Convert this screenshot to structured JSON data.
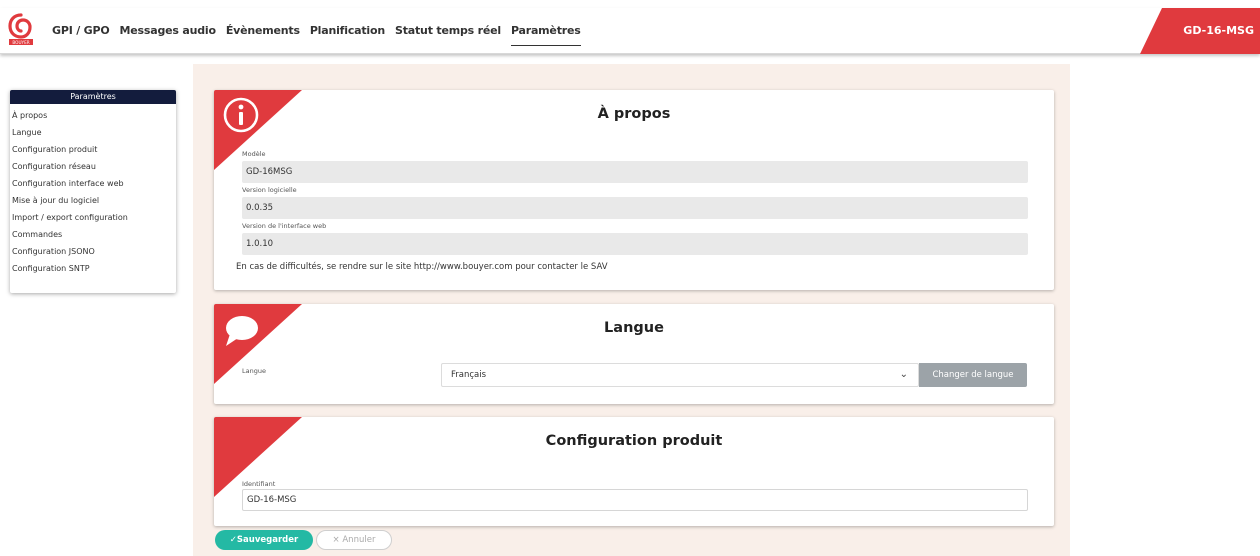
{
  "nav": {
    "items": [
      {
        "label": "GPI / GPO"
      },
      {
        "label": "Messages audio"
      },
      {
        "label": "Évènements"
      },
      {
        "label": "Planification"
      },
      {
        "label": "Statut temps réel"
      },
      {
        "label": "Paramètres"
      }
    ],
    "active_index": 5,
    "device": "GD-16-MSG"
  },
  "sidebar": {
    "title": "Paramètres",
    "items": [
      {
        "label": "À propos"
      },
      {
        "label": "Langue"
      },
      {
        "label": "Configuration produit"
      },
      {
        "label": "Configuration réseau"
      },
      {
        "label": "Configuration interface web"
      },
      {
        "label": "Mise à jour du logiciel"
      },
      {
        "label": "Import / export configuration"
      },
      {
        "label": "Commandes"
      },
      {
        "label": "Configuration JSONO"
      },
      {
        "label": "Configuration SNTP"
      }
    ]
  },
  "about": {
    "title": "À propos",
    "icon": "info-icon",
    "fields": [
      {
        "label": "Modèle",
        "value": "GD-16MSG"
      },
      {
        "label": "Version logicielle",
        "value": "0.0.35"
      },
      {
        "label": "Version de l'interface web",
        "value": "1.0.10"
      }
    ],
    "note": "En cas de difficultés, se rendre sur le site http://www.bouyer.com pour contacter le SAV"
  },
  "language": {
    "title": "Langue",
    "icon": "speech-bubble-icon",
    "label": "Langue",
    "selected": "Français",
    "button": "Changer de langue"
  },
  "product": {
    "title": "Configuration produit",
    "label": "Identifiant",
    "value": "GD-16-MSG"
  },
  "actions": {
    "save": "✓Sauvegarder",
    "cancel": "× Annuler"
  },
  "colors": {
    "accent_red": "#e03a3e",
    "sidebar_header": "#131c3d",
    "save_green": "#24b9a4",
    "panel_bg": "#f9efe9"
  }
}
